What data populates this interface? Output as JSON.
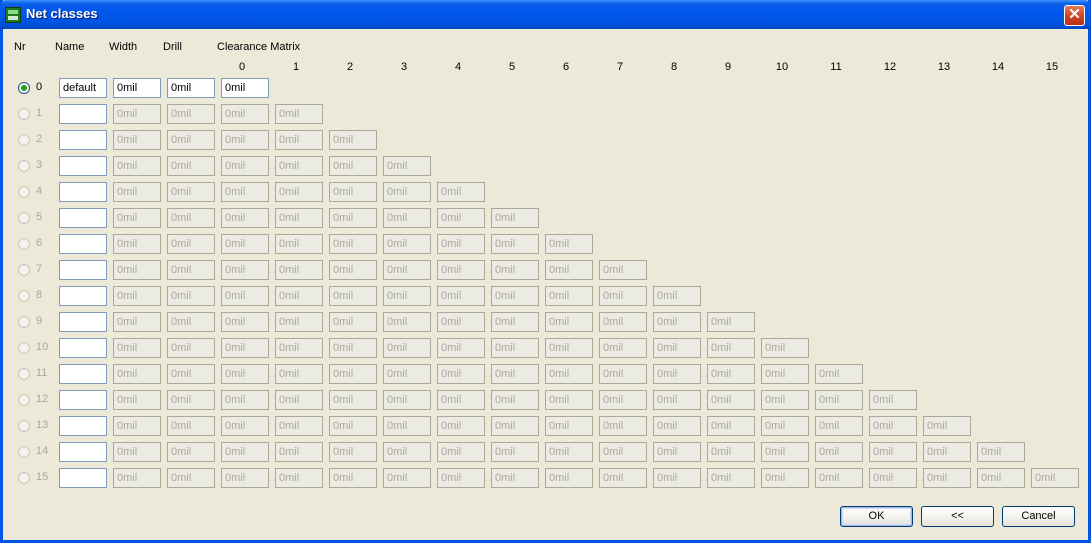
{
  "window": {
    "title": "Net classes",
    "close_glyph": "✕"
  },
  "headers": {
    "nr": "Nr",
    "name": "Name",
    "width": "Width",
    "drill": "Drill",
    "matrix": "Clearance Matrix"
  },
  "matrix_columns": [
    "0",
    "1",
    "2",
    "3",
    "4",
    "5",
    "6",
    "7",
    "8",
    "9",
    "10",
    "11",
    "12",
    "13",
    "14",
    "15"
  ],
  "rows": [
    {
      "nr": "0",
      "name": "default",
      "width": "0mil",
      "drill": "0mil",
      "selected": true,
      "enabled": true,
      "clearance": [
        "0mil"
      ]
    },
    {
      "nr": "1",
      "name": "",
      "width": "0mil",
      "drill": "0mil",
      "selected": false,
      "enabled": false,
      "clearance": [
        "0mil",
        "0mil"
      ]
    },
    {
      "nr": "2",
      "name": "",
      "width": "0mil",
      "drill": "0mil",
      "selected": false,
      "enabled": false,
      "clearance": [
        "0mil",
        "0mil",
        "0mil"
      ]
    },
    {
      "nr": "3",
      "name": "",
      "width": "0mil",
      "drill": "0mil",
      "selected": false,
      "enabled": false,
      "clearance": [
        "0mil",
        "0mil",
        "0mil",
        "0mil"
      ]
    },
    {
      "nr": "4",
      "name": "",
      "width": "0mil",
      "drill": "0mil",
      "selected": false,
      "enabled": false,
      "clearance": [
        "0mil",
        "0mil",
        "0mil",
        "0mil",
        "0mil"
      ]
    },
    {
      "nr": "5",
      "name": "",
      "width": "0mil",
      "drill": "0mil",
      "selected": false,
      "enabled": false,
      "clearance": [
        "0mil",
        "0mil",
        "0mil",
        "0mil",
        "0mil",
        "0mil"
      ]
    },
    {
      "nr": "6",
      "name": "",
      "width": "0mil",
      "drill": "0mil",
      "selected": false,
      "enabled": false,
      "clearance": [
        "0mil",
        "0mil",
        "0mil",
        "0mil",
        "0mil",
        "0mil",
        "0mil"
      ]
    },
    {
      "nr": "7",
      "name": "",
      "width": "0mil",
      "drill": "0mil",
      "selected": false,
      "enabled": false,
      "clearance": [
        "0mil",
        "0mil",
        "0mil",
        "0mil",
        "0mil",
        "0mil",
        "0mil",
        "0mil"
      ]
    },
    {
      "nr": "8",
      "name": "",
      "width": "0mil",
      "drill": "0mil",
      "selected": false,
      "enabled": false,
      "clearance": [
        "0mil",
        "0mil",
        "0mil",
        "0mil",
        "0mil",
        "0mil",
        "0mil",
        "0mil",
        "0mil"
      ]
    },
    {
      "nr": "9",
      "name": "",
      "width": "0mil",
      "drill": "0mil",
      "selected": false,
      "enabled": false,
      "clearance": [
        "0mil",
        "0mil",
        "0mil",
        "0mil",
        "0mil",
        "0mil",
        "0mil",
        "0mil",
        "0mil",
        "0mil"
      ]
    },
    {
      "nr": "10",
      "name": "",
      "width": "0mil",
      "drill": "0mil",
      "selected": false,
      "enabled": false,
      "clearance": [
        "0mil",
        "0mil",
        "0mil",
        "0mil",
        "0mil",
        "0mil",
        "0mil",
        "0mil",
        "0mil",
        "0mil",
        "0mil"
      ]
    },
    {
      "nr": "11",
      "name": "",
      "width": "0mil",
      "drill": "0mil",
      "selected": false,
      "enabled": false,
      "clearance": [
        "0mil",
        "0mil",
        "0mil",
        "0mil",
        "0mil",
        "0mil",
        "0mil",
        "0mil",
        "0mil",
        "0mil",
        "0mil",
        "0mil"
      ]
    },
    {
      "nr": "12",
      "name": "",
      "width": "0mil",
      "drill": "0mil",
      "selected": false,
      "enabled": false,
      "clearance": [
        "0mil",
        "0mil",
        "0mil",
        "0mil",
        "0mil",
        "0mil",
        "0mil",
        "0mil",
        "0mil",
        "0mil",
        "0mil",
        "0mil",
        "0mil"
      ]
    },
    {
      "nr": "13",
      "name": "",
      "width": "0mil",
      "drill": "0mil",
      "selected": false,
      "enabled": false,
      "clearance": [
        "0mil",
        "0mil",
        "0mil",
        "0mil",
        "0mil",
        "0mil",
        "0mil",
        "0mil",
        "0mil",
        "0mil",
        "0mil",
        "0mil",
        "0mil",
        "0mil"
      ]
    },
    {
      "nr": "14",
      "name": "",
      "width": "0mil",
      "drill": "0mil",
      "selected": false,
      "enabled": false,
      "clearance": [
        "0mil",
        "0mil",
        "0mil",
        "0mil",
        "0mil",
        "0mil",
        "0mil",
        "0mil",
        "0mil",
        "0mil",
        "0mil",
        "0mil",
        "0mil",
        "0mil",
        "0mil"
      ]
    },
    {
      "nr": "15",
      "name": "",
      "width": "0mil",
      "drill": "0mil",
      "selected": false,
      "enabled": false,
      "clearance": [
        "0mil",
        "0mil",
        "0mil",
        "0mil",
        "0mil",
        "0mil",
        "0mil",
        "0mil",
        "0mil",
        "0mil",
        "0mil",
        "0mil",
        "0mil",
        "0mil",
        "0mil",
        "0mil"
      ]
    }
  ],
  "buttons": {
    "ok": "OK",
    "collapse": "<<",
    "cancel": "Cancel"
  }
}
